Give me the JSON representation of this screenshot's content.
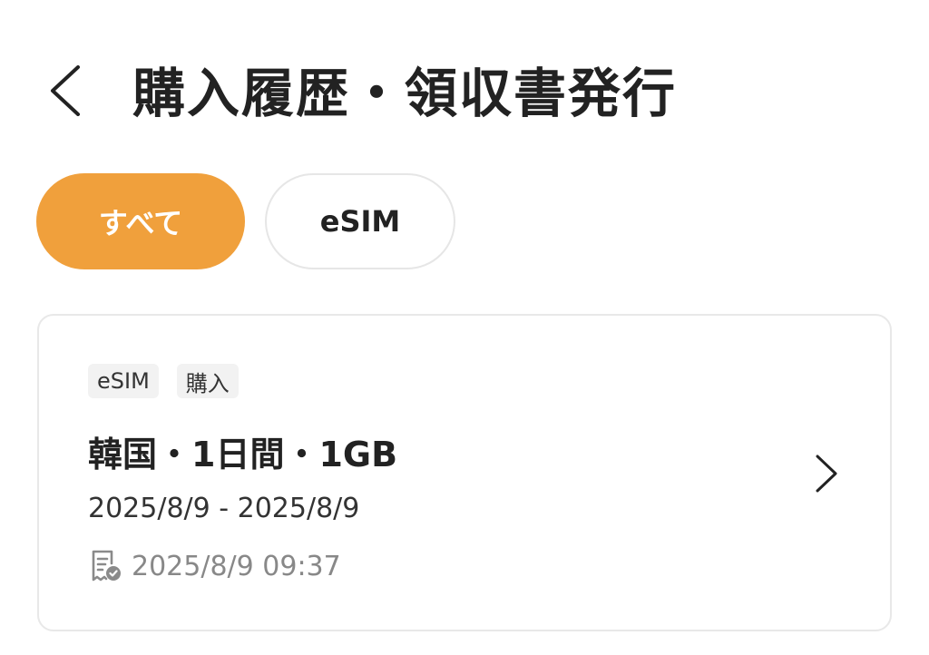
{
  "header": {
    "title": "購入履歴・領収書発行",
    "back_icon": "chevron-left-icon"
  },
  "filters": [
    {
      "label": "すべて",
      "active": true
    },
    {
      "label": "eSIM",
      "active": false
    }
  ],
  "colors": {
    "accent": "#F0A03C",
    "text": "#222222",
    "muted": "#888888",
    "tag_bg": "#f2f2f2",
    "border": "#e8e8e8"
  },
  "orders": [
    {
      "tags": [
        "eSIM",
        "購入"
      ],
      "title": "韓国・1日間・1GB",
      "period": "2025/8/9 - 2025/8/9",
      "purchased_at": "2025/8/9 09:37",
      "receipt_icon": "receipt-check-icon",
      "chevron_icon": "chevron-right-icon"
    }
  ]
}
